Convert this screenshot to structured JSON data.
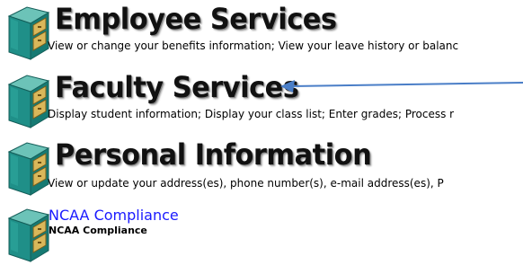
{
  "menu": {
    "items": [
      {
        "title": "Employee Services",
        "description": "View or change your benefits information; View your leave history or balanc"
      },
      {
        "title": "Faculty Services",
        "description": "Display student information; Display your class list; Enter grades; Process r"
      },
      {
        "title": "Personal Information",
        "description": "View or update your address(es), phone number(s), e-mail address(es), P"
      },
      {
        "title": "NCAA Compliance",
        "description": "NCAA Compliance"
      }
    ]
  },
  "colors": {
    "link": "#1a1aff",
    "arrow": "#4a7ec7",
    "icon_teal": "#1f8f88",
    "icon_drawer": "#c9a64a"
  }
}
